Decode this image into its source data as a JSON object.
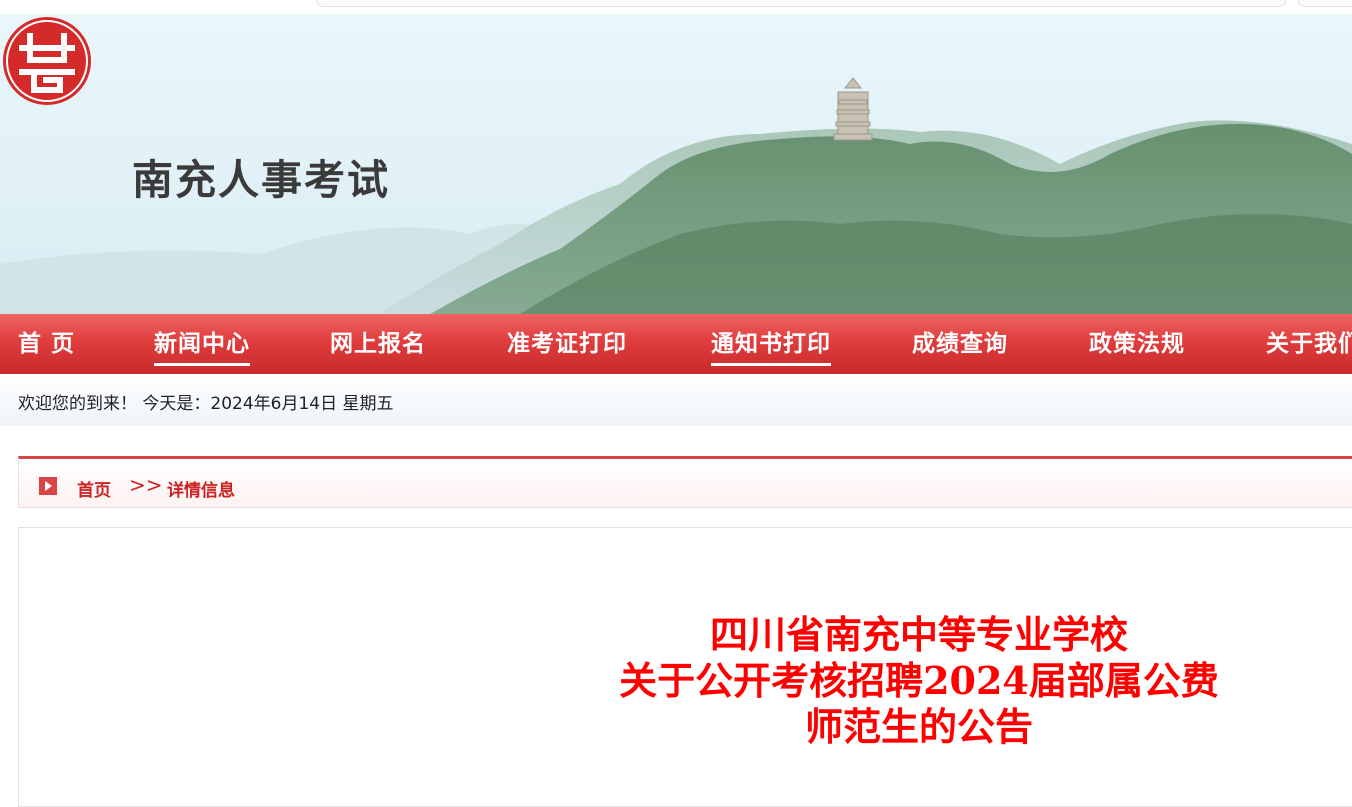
{
  "site": {
    "name": "南充人事考试"
  },
  "nav": {
    "items": [
      {
        "label": "首  页"
      },
      {
        "label": "新闻中心"
      },
      {
        "label": "网上报名"
      },
      {
        "label": "准考证打印"
      },
      {
        "label": "通知书打印"
      },
      {
        "label": "成绩查询"
      },
      {
        "label": "政策法规"
      },
      {
        "label": "关于我们"
      }
    ]
  },
  "welcome": {
    "text": "欢迎您的到来！ 今天是：2024年6月14日 星期五"
  },
  "breadcrumb": {
    "home": "首页",
    "separator": ">>",
    "current": "详情信息"
  },
  "article": {
    "title_lines": [
      "四川省南充中等专业学校",
      "关于公开考核招聘2024届部属公费",
      "师范生的公告"
    ]
  },
  "colors": {
    "accent": "#e03d3d",
    "title_red": "#ff0000"
  }
}
